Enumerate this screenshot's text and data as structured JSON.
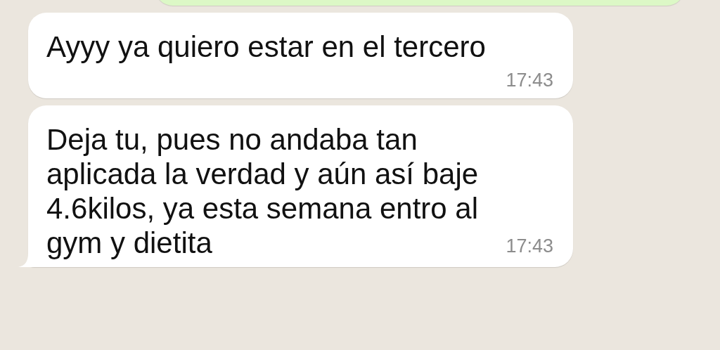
{
  "messages": [
    {
      "kind": "outgoing",
      "tail": false
    },
    {
      "kind": "incoming",
      "text": "Ayyy ya quiero estar en el tercero",
      "time": "17:43",
      "tail": false
    },
    {
      "kind": "incoming",
      "text": "Deja tu, pues no andaba tan aplicada la verdad y aún así baje 4.6kilos, ya esta semana entro al gym y dietita",
      "time": "17:43",
      "tail": true
    }
  ]
}
